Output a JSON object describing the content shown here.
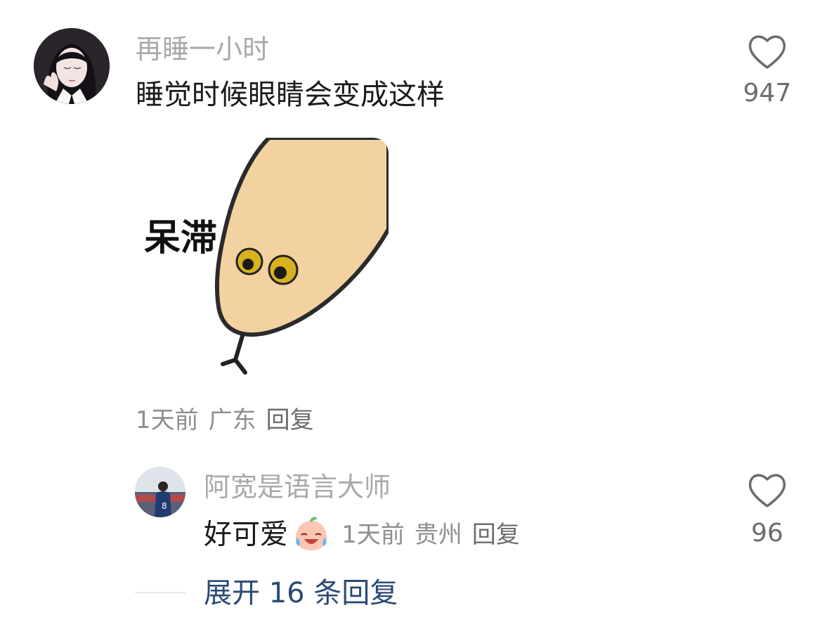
{
  "comment": {
    "username": "再睡一小时",
    "text": "睡觉时候眼睛会变成这样",
    "likes": "947",
    "sticker_text": "呆滞",
    "time": "1天前",
    "location": "广东",
    "reply_label": "回复"
  },
  "reply": {
    "username": "阿宽是语言大师",
    "text": "好可爱",
    "emoji_icon": "crying-laughing-face-icon",
    "time": "1天前",
    "location": "贵州",
    "reply_label": "回复",
    "likes": "96"
  },
  "expand": {
    "label": "展开 16 条回复"
  },
  "colors": {
    "username": "#a8a8ad",
    "body_text": "#1a1a1a",
    "meta_text": "#8e8e93",
    "link": "#2b4a76",
    "sticker_fill": "#f2d2a0"
  }
}
